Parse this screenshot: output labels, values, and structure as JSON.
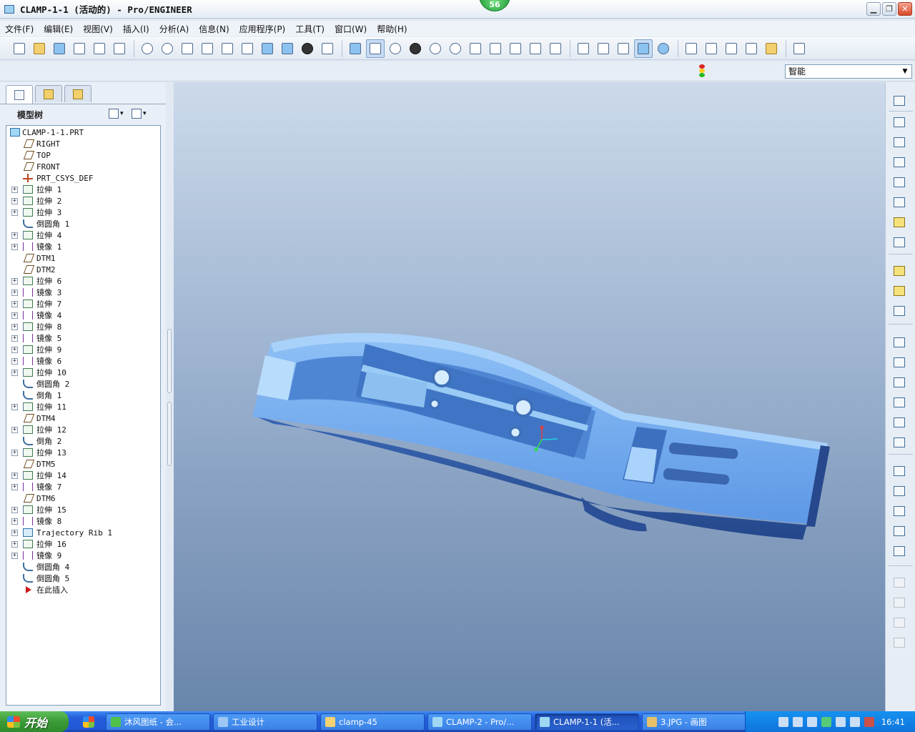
{
  "window": {
    "title": "CLAMP-1-1 (活动的) - Pro/ENGINEER",
    "badge": "56",
    "buttons": {
      "minimize": "▁",
      "restore": "❐",
      "close": "✕"
    }
  },
  "menu": [
    "文件(F)",
    "编辑(E)",
    "视图(V)",
    "插入(I)",
    "分析(A)",
    "信息(N)",
    "应用程序(P)",
    "工具(T)",
    "窗口(W)",
    "帮助(H)"
  ],
  "toolbar": {
    "icons": [
      "new-icon",
      "open-icon",
      "save-icon",
      "print-icon",
      "print-preview-icon",
      "send-icon",
      "undo-icon",
      "redo-icon",
      "cut-icon",
      "copy-icon",
      "paste-icon",
      "paste-special-icon",
      "regenerate-icon",
      "regenerate-manager-icon",
      "find-icon",
      "select-box-icon",
      "repaint-icon",
      "spin-center-icon",
      "orient-icon",
      "shading-sphere-icon",
      "zoom-in-icon",
      "zoom-out-icon",
      "refit-icon",
      "reorient-icon",
      "view-manager-icon",
      "layers-icon",
      "appearance-icon",
      "wireframe-icon",
      "hidden-line-icon",
      "no-hidden-icon",
      "shading-icon",
      "enhanced-realism-icon",
      "datum-plane-display-icon",
      "datum-axis-display-icon",
      "datum-point-display-icon",
      "csys-display-icon",
      "annotation-display-icon",
      "context-help-icon"
    ]
  },
  "filter": {
    "value": "智能",
    "arrow": "▼"
  },
  "left_panel": {
    "tree_title": "模型树",
    "tree_items": [
      {
        "label": "CLAMP-1-1.PRT",
        "type": "part",
        "expand": false
      },
      {
        "label": "RIGHT",
        "type": "plane",
        "expand": false
      },
      {
        "label": "TOP",
        "type": "plane",
        "expand": false
      },
      {
        "label": "FRONT",
        "type": "plane",
        "expand": false
      },
      {
        "label": "PRT_CSYS_DEF",
        "type": "csys",
        "expand": false
      },
      {
        "label": "拉伸 1",
        "type": "extrude",
        "expand": true
      },
      {
        "label": "拉伸 2",
        "type": "extrude",
        "expand": true
      },
      {
        "label": "拉伸 3",
        "type": "extrude",
        "expand": true
      },
      {
        "label": "倒圆角 1",
        "type": "round",
        "expand": false
      },
      {
        "label": "拉伸 4",
        "type": "extrude",
        "expand": true
      },
      {
        "label": "镜像 1",
        "type": "mirror",
        "expand": true
      },
      {
        "label": "DTM1",
        "type": "plane",
        "expand": false
      },
      {
        "label": "DTM2",
        "type": "plane",
        "expand": false
      },
      {
        "label": "拉伸 6",
        "type": "extrude",
        "expand": true
      },
      {
        "label": "镜像 3",
        "type": "mirror",
        "expand": true
      },
      {
        "label": "拉伸 7",
        "type": "extrude",
        "expand": true
      },
      {
        "label": "镜像 4",
        "type": "mirror",
        "expand": true
      },
      {
        "label": "拉伸 8",
        "type": "extrude",
        "expand": true
      },
      {
        "label": "镜像 5",
        "type": "mirror",
        "expand": true
      },
      {
        "label": "拉伸 9",
        "type": "extrude",
        "expand": true
      },
      {
        "label": "镜像 6",
        "type": "mirror",
        "expand": true
      },
      {
        "label": "拉伸 10",
        "type": "extrude",
        "expand": true
      },
      {
        "label": "倒圆角 2",
        "type": "round",
        "expand": false
      },
      {
        "label": "倒角 1",
        "type": "round",
        "expand": false
      },
      {
        "label": "拉伸 11",
        "type": "extrude",
        "expand": true
      },
      {
        "label": "DTM4",
        "type": "plane",
        "expand": false
      },
      {
        "label": "拉伸 12",
        "type": "extrude",
        "expand": true
      },
      {
        "label": "倒角 2",
        "type": "round",
        "expand": false
      },
      {
        "label": "拉伸 13",
        "type": "extrude",
        "expand": true
      },
      {
        "label": "DTM5",
        "type": "plane",
        "expand": false
      },
      {
        "label": "拉伸 14",
        "type": "extrude",
        "expand": true
      },
      {
        "label": "镜像 7",
        "type": "mirror",
        "expand": true
      },
      {
        "label": "DTM6",
        "type": "plane",
        "expand": false
      },
      {
        "label": "拉伸 15",
        "type": "extrude",
        "expand": true
      },
      {
        "label": "镜像 8",
        "type": "mirror",
        "expand": true
      },
      {
        "label": "Trajectory Rib 1",
        "type": "rib",
        "expand": true
      },
      {
        "label": "拉伸 16",
        "type": "extrude",
        "expand": true
      },
      {
        "label": "镜像 9",
        "type": "mirror",
        "expand": true
      },
      {
        "label": "倒圆角 4",
        "type": "round",
        "expand": false
      },
      {
        "label": "倒圆角 5",
        "type": "round",
        "expand": false
      },
      {
        "label": "在此插入",
        "type": "insert",
        "expand": false
      }
    ]
  },
  "colors": {
    "model_top": "#7fb6f2",
    "model_side": "#2f5aa3",
    "model_inner": "#5f97e3",
    "viewport_top": "#ccdaeb",
    "viewport_bottom": "#6885ab"
  },
  "taskbar": {
    "start": "开始",
    "tasks": [
      "沐风图纸 - 会...",
      "工业设计",
      "clamp-45",
      "CLAMP-2 - Pro/...",
      "CLAMP-1-1 (活...",
      "3.JPG - 画图"
    ],
    "active_index": 4,
    "clock": "16:41"
  }
}
